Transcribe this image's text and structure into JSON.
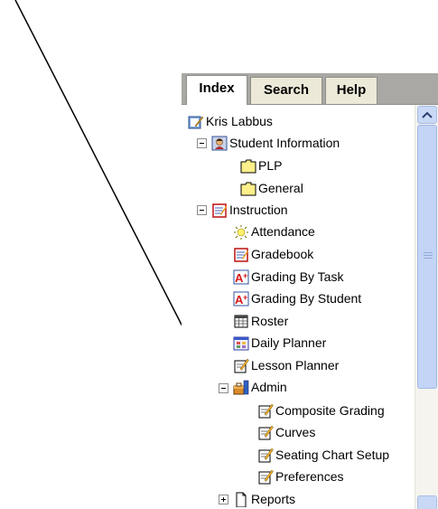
{
  "tabs": [
    {
      "label": "Index",
      "active": true
    },
    {
      "label": "Search",
      "active": false
    },
    {
      "label": "Help",
      "active": false
    }
  ],
  "tree": {
    "items": [
      {
        "label": "Kris Labbus",
        "icon": "notebook-icon"
      },
      {
        "label": "Student Information",
        "icon": "student-icon",
        "expander": "minus"
      },
      {
        "label": "PLP",
        "icon": "folder-icon"
      },
      {
        "label": "General",
        "icon": "folder-icon"
      },
      {
        "label": "Instruction",
        "icon": "gradebook-icon",
        "expander": "minus"
      },
      {
        "label": "Attendance",
        "icon": "attendance-icon"
      },
      {
        "label": "Gradebook",
        "icon": "gradebook-icon"
      },
      {
        "label": "Grading By Task",
        "icon": "grade-a-plus-icon"
      },
      {
        "label": "Grading By Student",
        "icon": "grade-a-plus-icon"
      },
      {
        "label": "Roster",
        "icon": "roster-icon"
      },
      {
        "label": "Daily Planner",
        "icon": "calendar-icon"
      },
      {
        "label": "Lesson Planner",
        "icon": "notepad-icon"
      },
      {
        "label": "Admin",
        "icon": "admin-toolbox-icon",
        "expander": "minus"
      },
      {
        "label": "Composite Grading",
        "icon": "notepad-icon"
      },
      {
        "label": "Curves",
        "icon": "notepad-icon"
      },
      {
        "label": "Seating Chart Setup",
        "icon": "notepad-icon"
      },
      {
        "label": "Preferences",
        "icon": "notepad-icon"
      },
      {
        "label": "Reports",
        "icon": "document-icon",
        "expander": "plus"
      }
    ]
  },
  "colors": {
    "tab_strip": "#a9a8a4",
    "folder": "#ffef8a",
    "scroll_thumb": "#c3d4f6",
    "arrow": "#000000"
  }
}
